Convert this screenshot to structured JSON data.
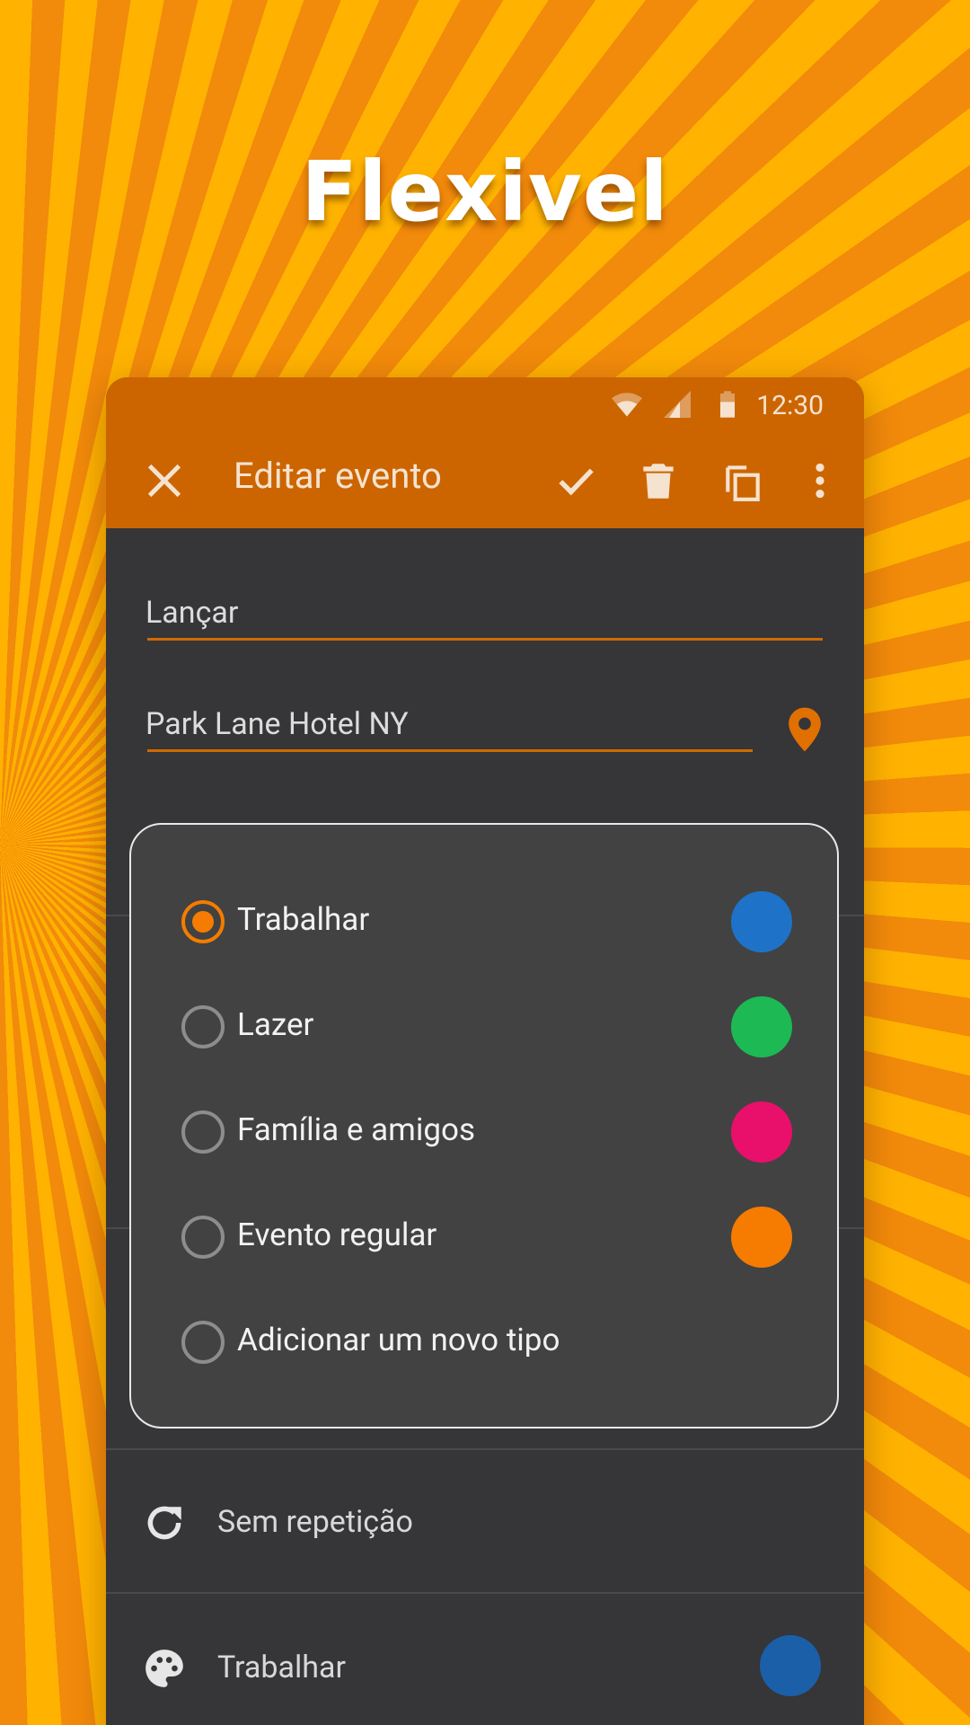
{
  "headline": "Flexivel",
  "status_bar": {
    "time": "12:30"
  },
  "toolbar": {
    "title": "Editar evento"
  },
  "form": {
    "title_value": "Lançar",
    "location_value": "Park Lane Hotel NY"
  },
  "event_type_dialog": {
    "options": [
      {
        "label": "Trabalhar",
        "selected": true,
        "color": "#1e73c8"
      },
      {
        "label": "Lazer",
        "selected": false,
        "color": "#1db954"
      },
      {
        "label": "Família e amigos",
        "selected": false,
        "color": "#e8106a"
      },
      {
        "label": "Evento regular",
        "selected": false,
        "color": "#f57c00"
      },
      {
        "label": "Adicionar um novo tipo",
        "selected": false
      }
    ]
  },
  "repeat_row": {
    "label": "Sem repetição"
  },
  "type_row": {
    "label": "Trabalhar",
    "color": "#1b5fa8"
  },
  "colors": {
    "accent": "#f57c00",
    "toolbar": "#cc6500",
    "background": "#363537"
  }
}
